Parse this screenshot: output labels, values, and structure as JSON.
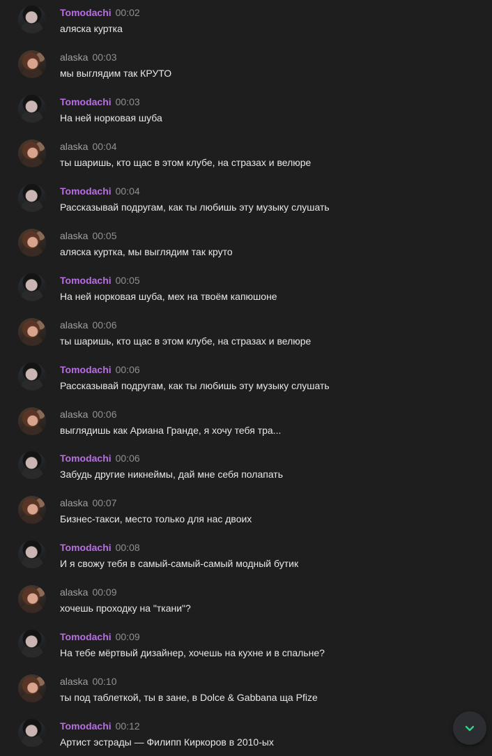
{
  "colors": {
    "background": "#1e1e1f",
    "tomodachi_name": "#b86fe0",
    "alaska_name": "#9ea0a4",
    "timestamp": "#8e9095",
    "message_text": "#e8e8ea",
    "scroll_arrow": "#2fd58a"
  },
  "messages": [
    {
      "author": "Tomodachi",
      "time": "00:02",
      "text": "аляска куртка"
    },
    {
      "author": "alaska",
      "time": "00:03",
      "text": "мы выглядим так КРУТО"
    },
    {
      "author": "Tomodachi",
      "time": "00:03",
      "text": "На ней норковая шуба"
    },
    {
      "author": "alaska",
      "time": "00:04",
      "text": "ты шаришь, кто щас в этом клубе, на стразах и велюре"
    },
    {
      "author": "Tomodachi",
      "time": "00:04",
      "text": "Рассказывай подругам, как ты любишь эту музыку слушать"
    },
    {
      "author": "alaska",
      "time": "00:05",
      "text": "аляска куртка, мы выглядим так круто"
    },
    {
      "author": "Tomodachi",
      "time": "00:05",
      "text": "На ней норковая шуба, мех на твоём капюшоне"
    },
    {
      "author": "alaska",
      "time": "00:06",
      "text": "ты шаришь, кто щас в этом клубе, на стразах и велюре"
    },
    {
      "author": "Tomodachi",
      "time": "00:06",
      "text": "Рассказывай подругам, как ты любишь эту музыку слушать"
    },
    {
      "author": "alaska",
      "time": "00:06",
      "text": "выглядишь как Ариана Гранде, я хочу тебя тра..."
    },
    {
      "author": "Tomodachi",
      "time": "00:06",
      "text": "Забудь другие никнеймы, дай мне себя полапать"
    },
    {
      "author": "alaska",
      "time": "00:07",
      "text": "Бизнес-такси, место только для нас двоих"
    },
    {
      "author": "Tomodachi",
      "time": "00:08",
      "text": "И я свожу тебя в самый-самый-самый модный бутик"
    },
    {
      "author": "alaska",
      "time": "00:09",
      "text": "хочешь проходку на \"ткани\"?"
    },
    {
      "author": "Tomodachi",
      "time": "00:09",
      "text": "На тебе мёртвый дизайнер, хочешь на кухне и в спальне?"
    },
    {
      "author": "alaska",
      "time": "00:10",
      "text": "ты под таблеткой, ты в зане, в Dolce & Gabbana ща Pfize"
    },
    {
      "author": "Tomodachi",
      "time": "00:12",
      "text": "Артист эстрады — Филипп Киркоров в 2010-ых"
    }
  ],
  "scroll_button": {
    "icon": "chevron-down-icon"
  }
}
